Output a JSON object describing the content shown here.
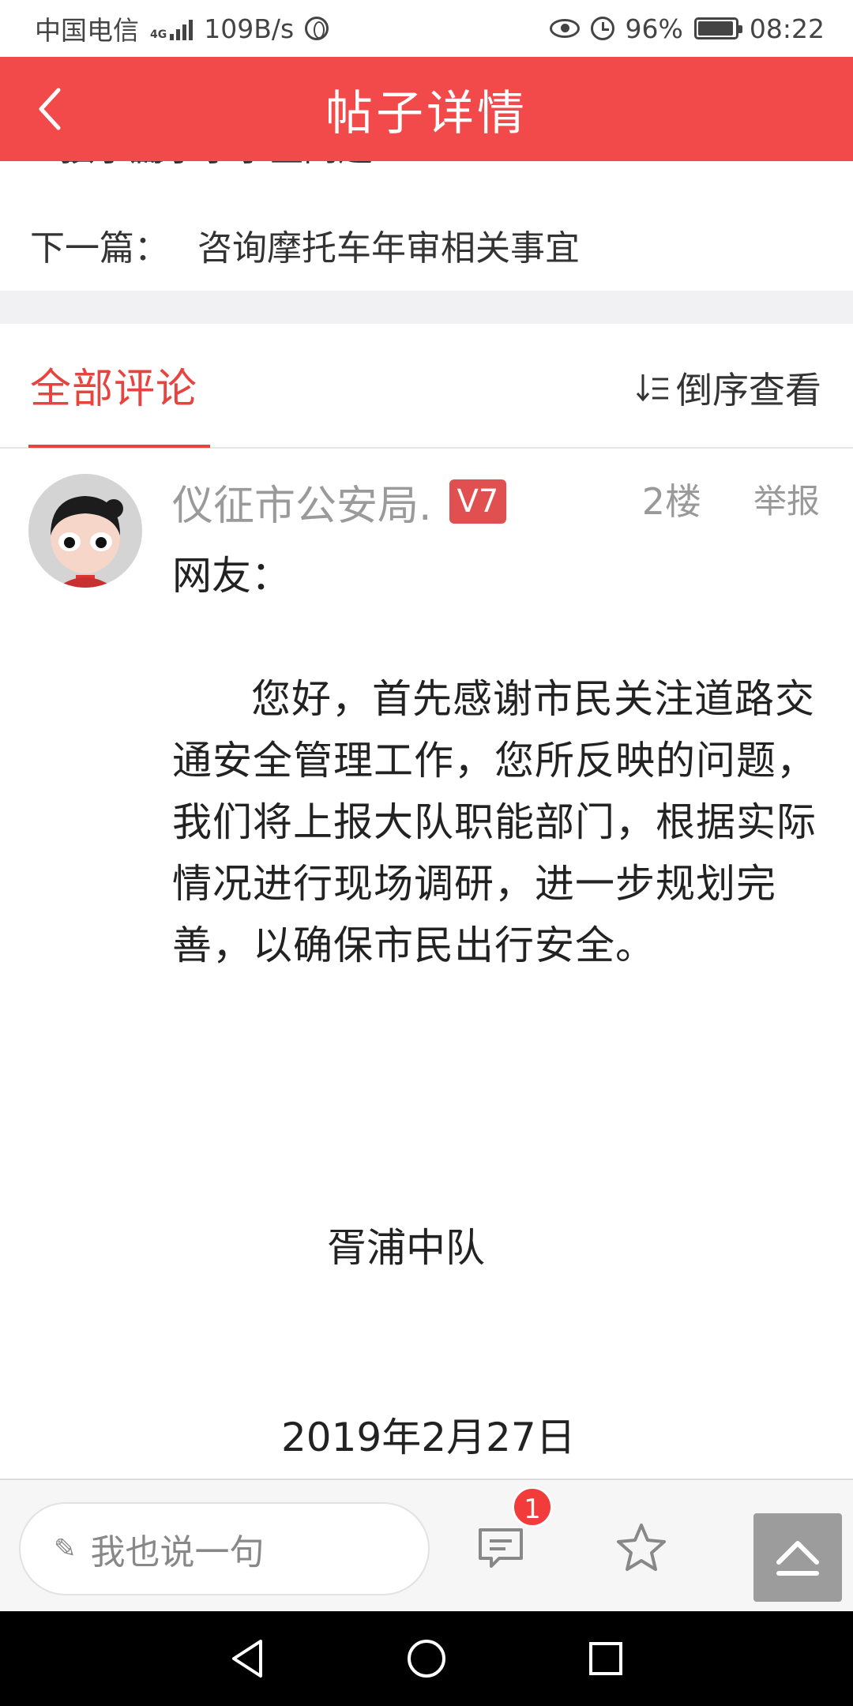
{
  "status_bar": {
    "carrier": "中国电信",
    "network": "4G",
    "speed": "109B/s",
    "battery": "96%",
    "battery_level": 0.96,
    "time": "08:22"
  },
  "header": {
    "title": "帖子详情",
    "back_icon": "chevron-left-icon"
  },
  "navigation": {
    "prev_label": "上一篇：",
    "prev_title": "孩子上小学学区问题",
    "next_label": "下一篇：",
    "next_title": "咨询摩托车年审相关事宜"
  },
  "comments_section": {
    "tab_label": "全部评论",
    "sort_label": "倒序查看",
    "sort_icon": "sort-desc-icon"
  },
  "comment": {
    "author": "仪征市公安局.",
    "level": "V7",
    "floor": "2楼",
    "report_label": "举报",
    "greeting": "网友：",
    "body": "您好，首先感谢市民关注道路交通安全管理工作，您所反映的问题，我们将上报大队职能部门，根据实际情况进行现场调研，进一步规划完善，以确保市民出行安全。",
    "signature": "胥浦中队",
    "date": "2019年2月27日"
  },
  "bottom_bar": {
    "input_placeholder": "我也说一句",
    "comment_count_badge": "1",
    "colors": {
      "accent": "#f24a4a",
      "badge": "#f23b3b"
    }
  }
}
